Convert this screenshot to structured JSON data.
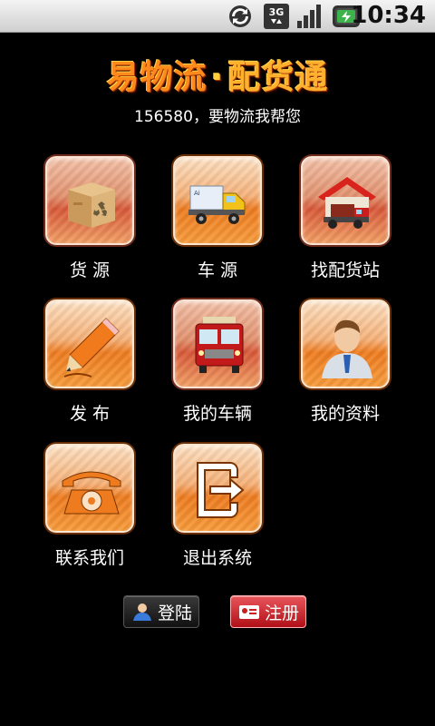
{
  "status_bar": {
    "time": "10:34",
    "icons": [
      "sync-icon",
      "3g-data-icon",
      "signal-strength-icon",
      "battery-icon"
    ]
  },
  "header": {
    "logo_main": "易物流",
    "logo_dot": "·",
    "logo_sub": "配货通",
    "subtitle": "156580，要物流我帮您"
  },
  "grid": {
    "items": [
      {
        "label": "货 源",
        "icon": "cargo-box-icon"
      },
      {
        "label": "车 源",
        "icon": "truck-icon"
      },
      {
        "label": "找配货站",
        "icon": "depot-icon"
      },
      {
        "label": "发 布",
        "icon": "pencil-icon"
      },
      {
        "label": "我的车辆",
        "icon": "bus-front-icon"
      },
      {
        "label": "我的资料",
        "icon": "user-profile-icon"
      },
      {
        "label": "联系我们",
        "icon": "telephone-icon"
      },
      {
        "label": "退出系统",
        "icon": "exit-icon"
      }
    ]
  },
  "buttons": {
    "login_label": "登陆",
    "register_label": "注册"
  },
  "colors": {
    "background": "#000000",
    "logo_orange": "#ff8a1c",
    "tile_red": "#d85a3a",
    "tile_orange": "#ee7d22",
    "register_red": "#b01018"
  }
}
